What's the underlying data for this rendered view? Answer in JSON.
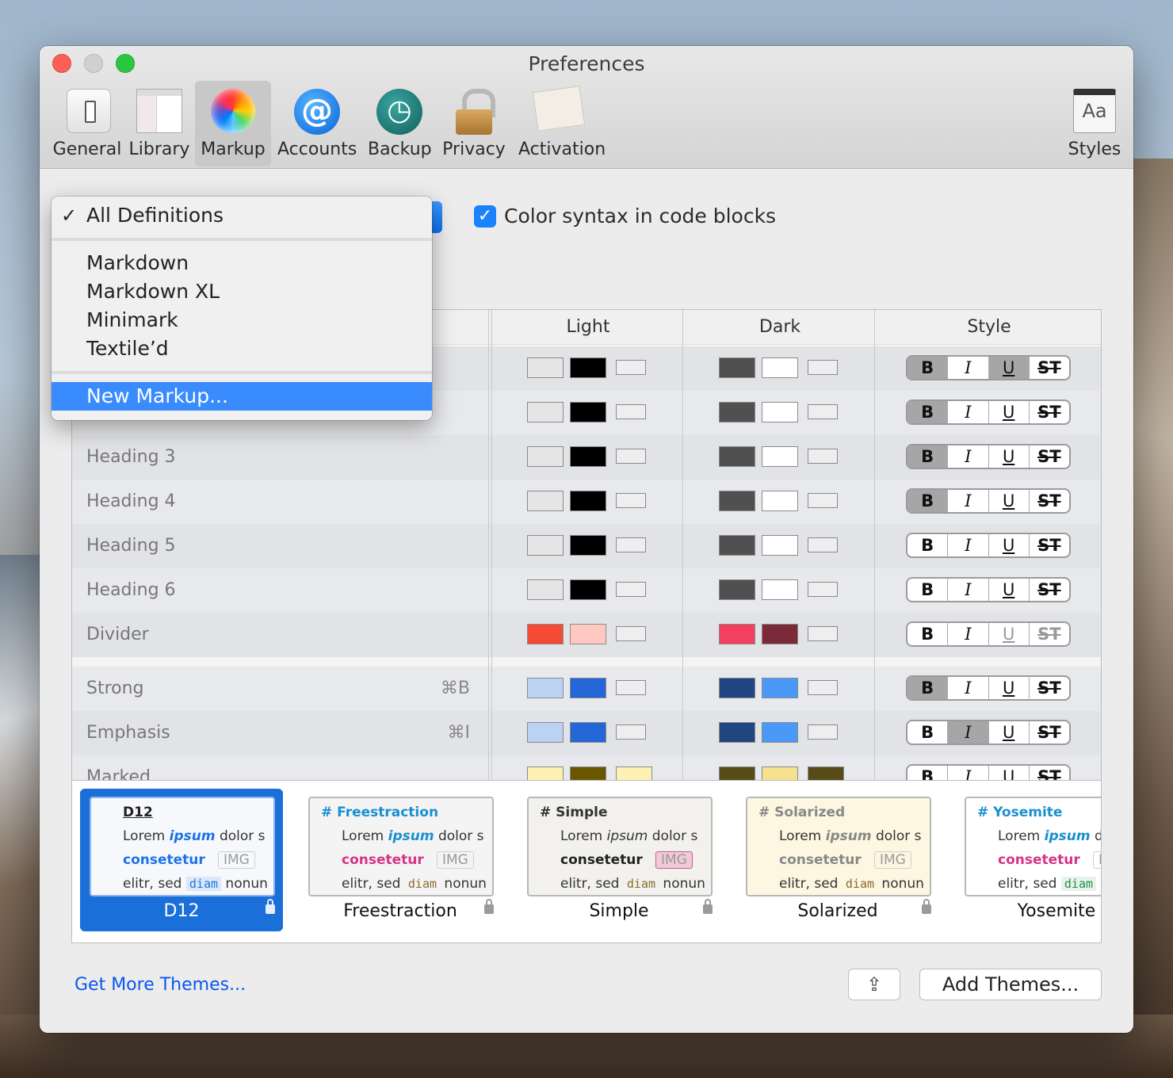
{
  "window": {
    "title": "Preferences"
  },
  "toolbar": {
    "items": [
      {
        "label": "General",
        "icon": "general-icon"
      },
      {
        "label": "Library",
        "icon": "library-icon"
      },
      {
        "label": "Markup",
        "icon": "markup-icon",
        "active": true
      },
      {
        "label": "Accounts",
        "icon": "accounts-icon"
      },
      {
        "label": "Backup",
        "icon": "backup-icon"
      },
      {
        "label": "Privacy",
        "icon": "privacy-icon"
      },
      {
        "label": "Activation",
        "icon": "activation-icon"
      }
    ],
    "styles_label": "Styles",
    "styles_icon_text": "Aa"
  },
  "dropdown": {
    "checked": "All Definitions",
    "items": [
      "Markdown",
      "Markdown XL",
      "Minimark",
      "Textile’d"
    ],
    "new_item": "New Markup..."
  },
  "color_syntax": {
    "label": "Color syntax in code blocks",
    "checked": true
  },
  "table": {
    "headers": [
      "Light",
      "Dark",
      "Style"
    ],
    "rows": [
      {
        "label": "",
        "shortcut": "",
        "light": [
          "#e5e5e5",
          "#000000",
          "#eeeeee"
        ],
        "dark": [
          "#505050",
          "#ffffff",
          "#eeeeee"
        ],
        "style": [
          "on",
          "off",
          "on",
          "off"
        ]
      },
      {
        "label": "",
        "shortcut": "",
        "light": [
          "#e5e5e5",
          "#000000",
          "#eeeeee"
        ],
        "dark": [
          "#505050",
          "#ffffff",
          "#eeeeee"
        ],
        "style": [
          "on",
          "off",
          "off",
          "off"
        ]
      },
      {
        "label": "Heading 3",
        "shortcut": "",
        "light": [
          "#e5e5e5",
          "#000000",
          "#eeeeee"
        ],
        "dark": [
          "#505050",
          "#ffffff",
          "#eeeeee"
        ],
        "style": [
          "on",
          "off",
          "off",
          "off"
        ]
      },
      {
        "label": "Heading 4",
        "shortcut": "",
        "light": [
          "#e5e5e5",
          "#000000",
          "#eeeeee"
        ],
        "dark": [
          "#505050",
          "#ffffff",
          "#eeeeee"
        ],
        "style": [
          "on",
          "off",
          "off",
          "off"
        ]
      },
      {
        "label": "Heading 5",
        "shortcut": "",
        "light": [
          "#e5e5e5",
          "#000000",
          "#eeeeee"
        ],
        "dark": [
          "#505050",
          "#ffffff",
          "#eeeeee"
        ],
        "style": [
          "off",
          "off",
          "off",
          "off"
        ]
      },
      {
        "label": "Heading 6",
        "shortcut": "",
        "light": [
          "#e5e5e5",
          "#000000",
          "#eeeeee"
        ],
        "dark": [
          "#505050",
          "#ffffff",
          "#eeeeee"
        ],
        "style": [
          "off",
          "off",
          "off",
          "off"
        ]
      },
      {
        "label": "Divider",
        "shortcut": "",
        "light": [
          "#f54a33",
          "#ffc9c1",
          "#eeeeee"
        ],
        "dark": [
          "#f44060",
          "#7a2a38",
          "#eeeeee"
        ],
        "style": [
          "off",
          "off",
          "dim",
          "dim"
        ]
      },
      {
        "label": "Strong",
        "shortcut": "⌘B",
        "light": [
          "#bcd2f3",
          "#2566d6",
          "#eeeeee"
        ],
        "dark": [
          "#1f4680",
          "#4a98f7",
          "#eeeeee"
        ],
        "style": [
          "on",
          "off",
          "off",
          "off"
        ]
      },
      {
        "label": "Emphasis",
        "shortcut": "⌘I",
        "light": [
          "#bcd2f3",
          "#2566d6",
          "#eeeeee"
        ],
        "dark": [
          "#1f4680",
          "#4a98f7",
          "#eeeeee"
        ],
        "style": [
          "off",
          "on",
          "off",
          "off"
        ]
      },
      {
        "label": "Marked",
        "shortcut": "",
        "light": [
          "#fdf0b3",
          "#6b5600",
          "#fdf0b3"
        ],
        "dark": [
          "#574b17",
          "#f6e190",
          "#574b17"
        ],
        "style": [
          "off",
          "off",
          "off",
          "off"
        ]
      }
    ],
    "style_letters": [
      "B",
      "I",
      "U",
      "S"
    ]
  },
  "themes": [
    {
      "name": "D12",
      "heading": "D12",
      "selected": true,
      "accent": "#1d72e8",
      "bg": "#f6f8fb"
    },
    {
      "name": "Freestraction",
      "heading": "# Freestraction",
      "accent": "#1a8fd0",
      "bg": "#f4f4f4"
    },
    {
      "name": "Simple",
      "heading": "# Simple",
      "accent": "#333333",
      "bg": "#f2f1ee"
    },
    {
      "name": "Solarized",
      "heading": "# Solarized",
      "accent": "#888888",
      "bg": "#fdf6e1"
    },
    {
      "name": "Yosemite",
      "heading": "# Yosemite",
      "accent": "#1a8fd0",
      "bg": "#ffffff"
    }
  ],
  "theme_sample": {
    "lorem": "Lorem",
    "ipsum": "ipsum",
    "dolor": "dolor s",
    "consetetur": "consetetur",
    "img": "IMG",
    "elitr": "elitr, sed",
    "diam": "diam",
    "nonun": "nonun"
  },
  "footer": {
    "get_more": "Get More Themes...",
    "add_themes": "Add Themes...",
    "share_icon": "share-icon"
  }
}
